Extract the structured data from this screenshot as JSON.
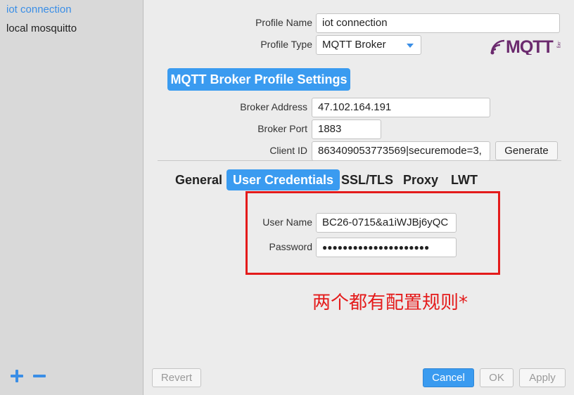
{
  "sidebar": {
    "items": [
      {
        "label": "iot connection",
        "selected": true
      },
      {
        "label": "local mosquitto",
        "selected": false
      }
    ],
    "add_icon": "plus-icon",
    "remove_icon": "minus-icon"
  },
  "profile": {
    "name_label": "Profile Name",
    "name_value": "iot connection",
    "type_label": "Profile Type",
    "type_value": "MQTT Broker",
    "logo_text": "MQTT",
    "logo_small": ".org"
  },
  "section": {
    "title": "MQTT Broker Profile Settings"
  },
  "broker": {
    "address_label": "Broker Address",
    "address_value": "47.102.164.191",
    "port_label": "Broker Port",
    "port_value": "1883",
    "client_id_label": "Client ID",
    "client_id_value": "863409053773569|securemode=3,",
    "generate_label": "Generate"
  },
  "tabs": [
    {
      "label": "General",
      "active": false
    },
    {
      "label": "User Credentials",
      "active": true
    },
    {
      "label": "SSL/TLS",
      "active": false
    },
    {
      "label": "Proxy",
      "active": false
    },
    {
      "label": "LWT",
      "active": false
    }
  ],
  "credentials": {
    "username_label": "User Name",
    "username_value": "BC26-0715&a1iWJBj6yQC",
    "password_label": "Password",
    "password_value": "●●●●●●●●●●●●●●●●●●●●●"
  },
  "annotation": "两个都有配置规则*",
  "footer": {
    "revert_label": "Revert",
    "cancel_label": "Cancel",
    "ok_label": "OK",
    "apply_label": "Apply"
  },
  "colors": {
    "accent": "#3a9bf0",
    "annotation_red": "#e41b1b",
    "logo_purple": "#6b2a6e"
  }
}
